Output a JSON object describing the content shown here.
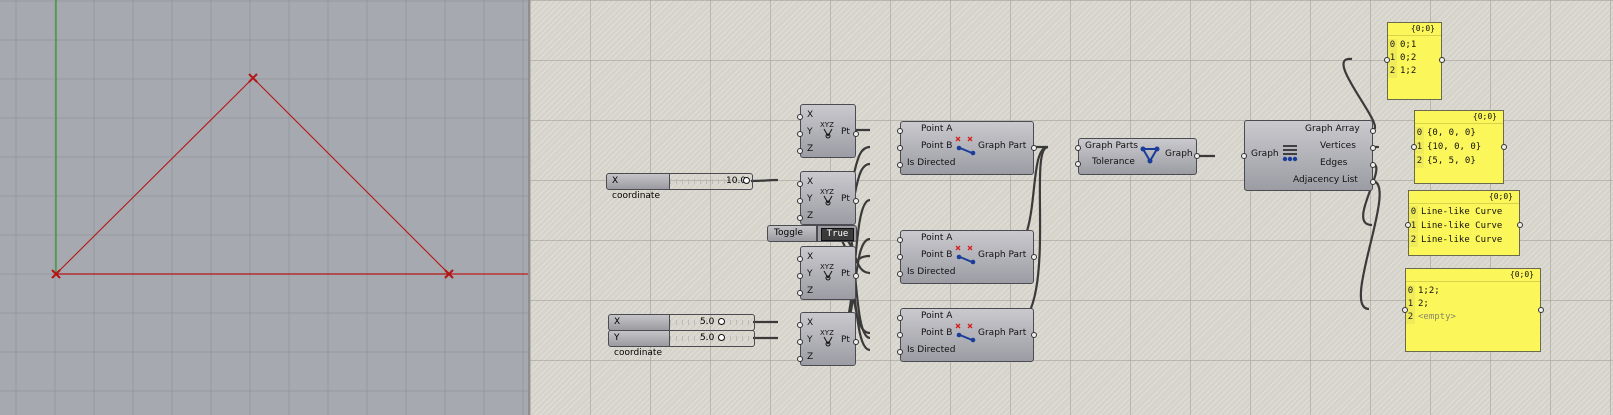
{
  "viewport": {
    "background": "#a6aab0",
    "grid_color": "#8f959d",
    "axis_y_color": "#2c9a2c",
    "axis_x_color": "#c01a1a",
    "curve_color": "#b51515",
    "point_marker": "cross-icon"
  },
  "sliders": [
    {
      "name": "X coordinate",
      "value": "10.0"
    },
    {
      "name": "X coordinate",
      "value": "5.0"
    },
    {
      "name": "Y coordinate",
      "value": "5.0"
    }
  ],
  "toggle": {
    "name": "Toggle",
    "value": "True"
  },
  "pt_component": {
    "inputs": [
      "X",
      "Y",
      "Z"
    ],
    "output": "Pt",
    "icon": "xyz-point-icon"
  },
  "graph_part": {
    "inputs": [
      "Point A",
      "Point B",
      "Is Directed"
    ],
    "output": "Graph Part",
    "icon": "graph-edge-icon"
  },
  "graph_builder": {
    "inputs": [
      "Graph Parts",
      "Tolerance"
    ],
    "output": "Graph",
    "icon": "graph-triangle-icon"
  },
  "graph_deconstruct": {
    "input": "Graph",
    "outputs": [
      "Graph Array",
      "Vertices",
      "Edges",
      "Adjacency List"
    ],
    "icon": "graph-list-icon"
  },
  "panels": [
    {
      "title": "{0;0}",
      "rows": [
        {
          "i": "0",
          "t": "0;1"
        },
        {
          "i": "1",
          "t": "0;2"
        },
        {
          "i": "2",
          "t": "1;2"
        }
      ]
    },
    {
      "title": "{0;0}",
      "rows": [
        {
          "i": "0",
          "t": "{0, 0, 0}"
        },
        {
          "i": "1",
          "t": "{10, 0, 0}"
        },
        {
          "i": "2",
          "t": "{5, 5, 0}"
        }
      ]
    },
    {
      "title": "{0;0}",
      "rows": [
        {
          "i": "0",
          "t": "Line-like Curve"
        },
        {
          "i": "1",
          "t": "Line-like Curve"
        },
        {
          "i": "2",
          "t": "Line-like Curve"
        }
      ]
    },
    {
      "title": "{0;0}",
      "rows": [
        {
          "i": "0",
          "t": "1;2;"
        },
        {
          "i": "1",
          "t": "2;"
        },
        {
          "i": "2",
          "t": "<empty>"
        }
      ]
    }
  ]
}
